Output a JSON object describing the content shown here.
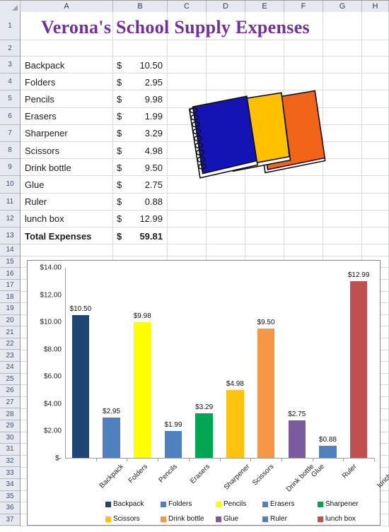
{
  "spreadsheet": {
    "column_headers": [
      "A",
      "B",
      "C",
      "D",
      "E",
      "F",
      "G",
      "H"
    ],
    "row_numbers": [
      1,
      2,
      3,
      4,
      5,
      6,
      7,
      8,
      9,
      10,
      11,
      12,
      13,
      14,
      15,
      16,
      17,
      18,
      19,
      20,
      21,
      22,
      23,
      24,
      25,
      26,
      27,
      28,
      29,
      30,
      31,
      32,
      33,
      34,
      35,
      36,
      37
    ],
    "title": "Verona's School Supply Expenses",
    "title_color": "#7030A0",
    "rows": [
      {
        "row": 3,
        "item": "Backpack",
        "currency": "$",
        "amount": "10.50",
        "bold": false
      },
      {
        "row": 4,
        "item": "Folders",
        "currency": "$",
        "amount": "2.95",
        "bold": false
      },
      {
        "row": 5,
        "item": "Pencils",
        "currency": "$",
        "amount": "9.98",
        "bold": false
      },
      {
        "row": 6,
        "item": "Erasers",
        "currency": "$",
        "amount": "1.99",
        "bold": false
      },
      {
        "row": 7,
        "item": "Sharpener",
        "currency": "$",
        "amount": "3.29",
        "bold": false
      },
      {
        "row": 8,
        "item": "Scissors",
        "currency": "$",
        "amount": "4.98",
        "bold": false
      },
      {
        "row": 9,
        "item": "Drink bottle",
        "currency": "$",
        "amount": "9.50",
        "bold": false
      },
      {
        "row": 10,
        "item": "Glue",
        "currency": "$",
        "amount": "2.75",
        "bold": false
      },
      {
        "row": 11,
        "item": "Ruler",
        "currency": "$",
        "amount": "0.88",
        "bold": false
      },
      {
        "row": 12,
        "item": "lunch box",
        "currency": "$",
        "amount": "12.99",
        "bold": false
      },
      {
        "row": 13,
        "item": "Total Expenses",
        "currency": "$",
        "amount": "59.81",
        "bold": true
      }
    ]
  },
  "clipart": {
    "name": "spiral-notebooks",
    "colors": [
      "#1414B4",
      "#FFC000",
      "#F26418"
    ]
  },
  "chart_data": {
    "type": "bar",
    "title": "",
    "xlabel": "",
    "ylabel": "",
    "ylim": [
      0,
      14
    ],
    "grid": false,
    "legend_position": "bottom",
    "ytick_labels": [
      "$-",
      "$2.00",
      "$4.00",
      "$6.00",
      "$8.00",
      "$10.00",
      "$12.00",
      "$14.00"
    ],
    "ytick_values": [
      0,
      2,
      4,
      6,
      8,
      10,
      12,
      14
    ],
    "categories": [
      "Backpack",
      "Folders",
      "Pencils",
      "Erasers",
      "Sharpener",
      "Scissors",
      "Drink bottle",
      "Glue",
      "Ruler",
      "lunch box"
    ],
    "values": [
      10.5,
      2.95,
      9.98,
      1.99,
      3.29,
      4.98,
      9.5,
      2.75,
      0.88,
      12.99
    ],
    "data_labels": [
      "$10.50",
      "$2.95",
      "$9.98",
      "$1.99",
      "$3.29",
      "$4.98",
      "$9.50",
      "$2.75",
      "$0.88",
      "$12.99"
    ],
    "colors": [
      "#1F4576",
      "#4E81BD",
      "#FFFF00",
      "#4E81BD",
      "#00A651",
      "#FFC20E",
      "#F79646",
      "#7B5AA0",
      "#4E81BD",
      "#C0504D"
    ],
    "legend": [
      {
        "label": "Backpack",
        "color": "#1F4576"
      },
      {
        "label": "Folders",
        "color": "#4E81BD"
      },
      {
        "label": "Pencils",
        "color": "#FFFF00"
      },
      {
        "label": "Erasers",
        "color": "#4E81BD"
      },
      {
        "label": "Sharpener",
        "color": "#00A651"
      },
      {
        "label": "Scissors",
        "color": "#FFC20E"
      },
      {
        "label": "Drink bottle",
        "color": "#F79646"
      },
      {
        "label": "Glue",
        "color": "#7B5AA0"
      },
      {
        "label": "Ruler",
        "color": "#4E81BD"
      },
      {
        "label": "lunch box",
        "color": "#C0504D"
      }
    ]
  }
}
